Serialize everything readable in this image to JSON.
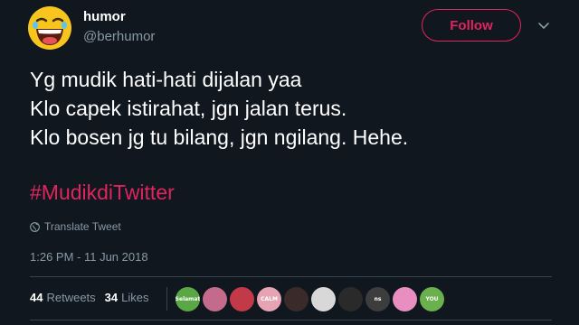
{
  "header": {
    "display_name": "humor",
    "handle": "@berhumor",
    "follow_label": "Follow",
    "avatar_icon": "laughing-face-icon",
    "menu_icon": "chevron-down-icon"
  },
  "tweet": {
    "lines": [
      "Yg mudik hati-hati dijalan yaa",
      "Klo capek istirahat, jgn jalan terus.",
      "Klo bosen jg tu bilang, jgn ngilang. Hehe."
    ],
    "hashtag": "#MudikdiTwitter",
    "translate_label": "Translate Tweet",
    "timestamp": "1:26 PM - 11 Jun 2018"
  },
  "stats": {
    "retweets_count": "44",
    "retweets_label": "Retweets",
    "likes_count": "34",
    "likes_label": "Likes"
  },
  "likers": [
    {
      "name": "liker-avatar-1",
      "text": "Selamat",
      "color": "#5aa845"
    },
    {
      "name": "liker-avatar-2",
      "text": "",
      "color": "#c46a8a"
    },
    {
      "name": "liker-avatar-3",
      "text": "",
      "color": "#c23a48"
    },
    {
      "name": "liker-avatar-4",
      "text": "CALM",
      "color": "#e6a3b4"
    },
    {
      "name": "liker-avatar-5",
      "text": "",
      "color": "#3a2a2a"
    },
    {
      "name": "liker-avatar-6",
      "text": "",
      "color": "#d8d8d8"
    },
    {
      "name": "liker-avatar-7",
      "text": "",
      "color": "#2a2a2a"
    },
    {
      "name": "liker-avatar-8",
      "text": "ns",
      "color": "#3d3d3d"
    },
    {
      "name": "liker-avatar-9",
      "text": "",
      "color": "#e98ec0"
    },
    {
      "name": "liker-avatar-10",
      "text": "YOU",
      "color": "#6ab04c"
    }
  ],
  "colors": {
    "background": "#10171e",
    "accent": "#e0245e",
    "muted": "#8899a6",
    "divider": "#38444d"
  }
}
